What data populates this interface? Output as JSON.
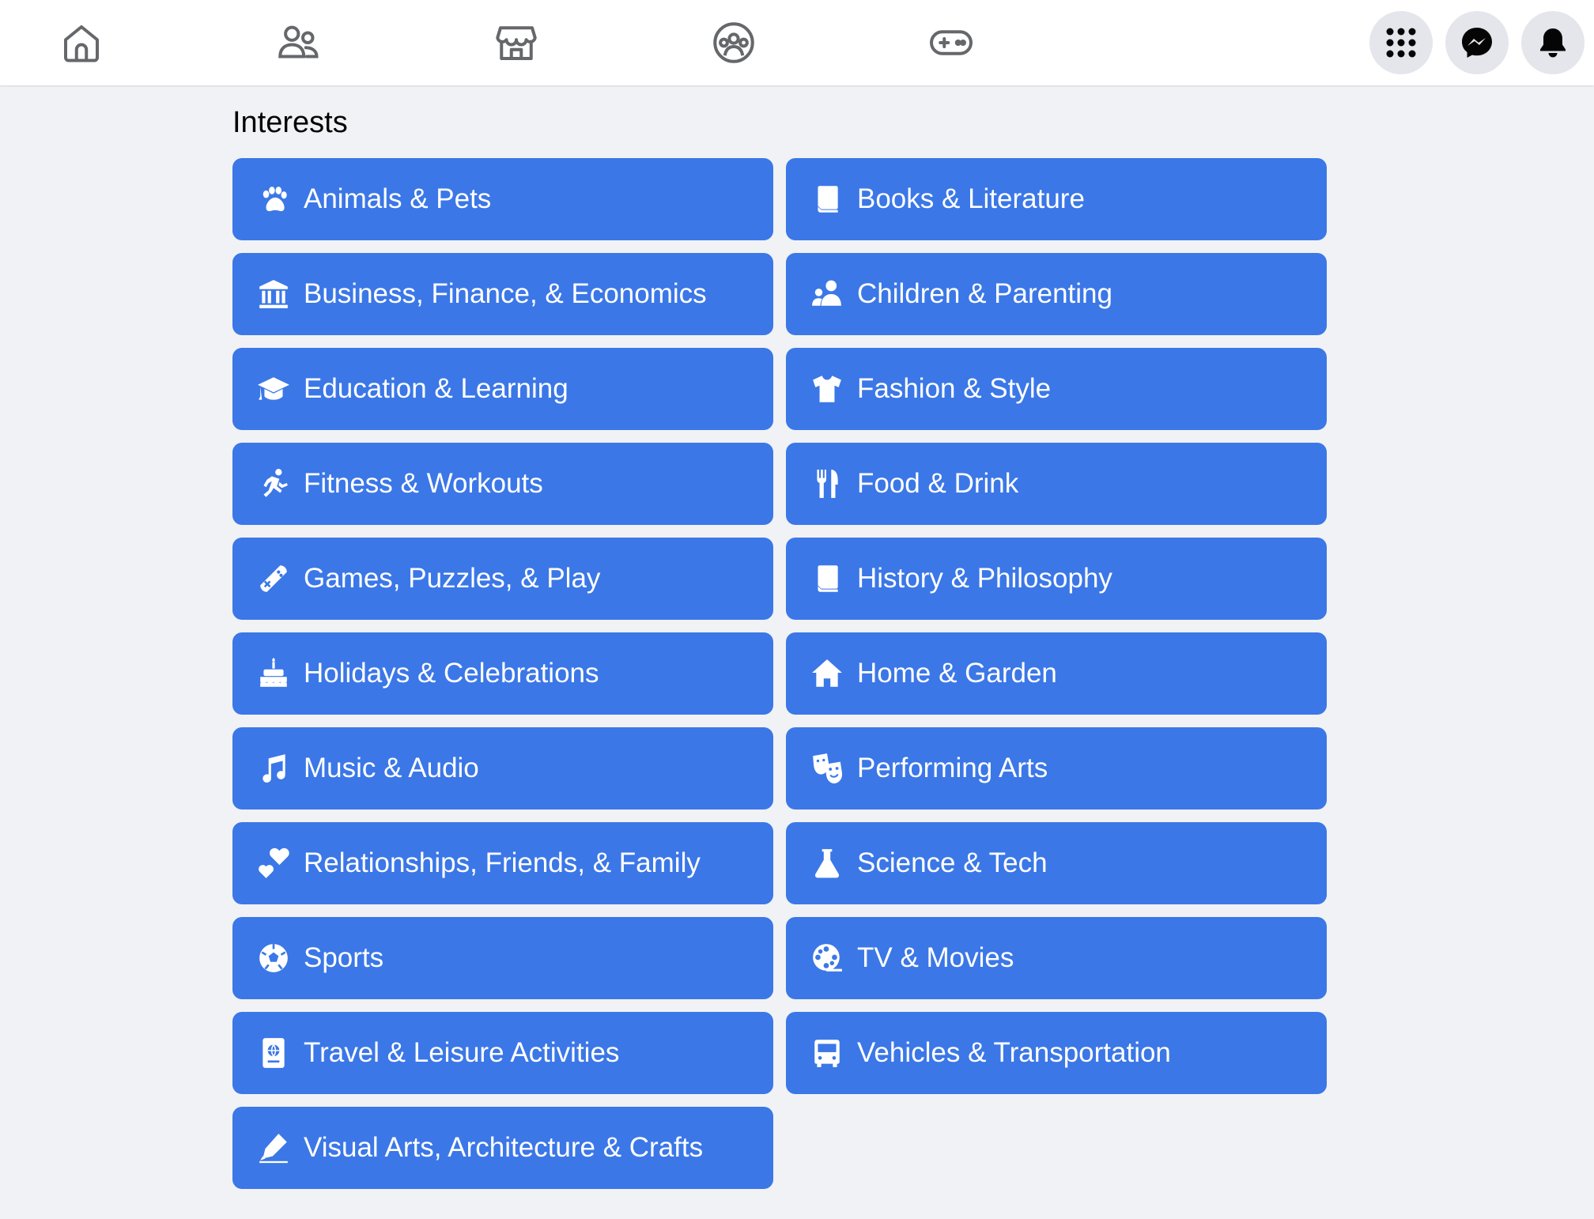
{
  "nav": {
    "icons": [
      {
        "name": "home-icon"
      },
      {
        "name": "friends-icon"
      },
      {
        "name": "marketplace-icon"
      },
      {
        "name": "groups-icon"
      },
      {
        "name": "gaming-icon"
      }
    ],
    "right_buttons": [
      {
        "name": "menu-grid-icon"
      },
      {
        "name": "messenger-icon"
      },
      {
        "name": "notifications-bell-icon"
      }
    ]
  },
  "page": {
    "title": "Interests"
  },
  "colors": {
    "tile": "#3b77e7",
    "background": "#f0f2f5",
    "topbar": "#ffffff",
    "nav_icon": "#65676b"
  },
  "interests": [
    {
      "label": "Animals & Pets",
      "icon": "paw-icon"
    },
    {
      "label": "Books & Literature",
      "icon": "book-icon"
    },
    {
      "label": "Business, Finance, & Economics",
      "icon": "bank-icon"
    },
    {
      "label": "Children & Parenting",
      "icon": "parent-child-icon"
    },
    {
      "label": "Education & Learning",
      "icon": "graduation-cap-icon"
    },
    {
      "label": "Fashion & Style",
      "icon": "tshirt-icon"
    },
    {
      "label": "Fitness & Workouts",
      "icon": "running-person-icon"
    },
    {
      "label": "Food & Drink",
      "icon": "fork-knife-icon"
    },
    {
      "label": "Games, Puzzles, & Play",
      "icon": "game-controller-icon"
    },
    {
      "label": "History & Philosophy",
      "icon": "book-icon"
    },
    {
      "label": "Holidays & Celebrations",
      "icon": "cake-icon"
    },
    {
      "label": "Home & Garden",
      "icon": "house-icon"
    },
    {
      "label": "Music & Audio",
      "icon": "music-note-icon"
    },
    {
      "label": "Performing Arts",
      "icon": "theater-masks-icon"
    },
    {
      "label": "Relationships, Friends, & Family",
      "icon": "hearts-icon"
    },
    {
      "label": "Science & Tech",
      "icon": "flask-icon"
    },
    {
      "label": "Sports",
      "icon": "soccer-ball-icon"
    },
    {
      "label": "TV & Movies",
      "icon": "film-reel-icon"
    },
    {
      "label": "Travel & Leisure Activities",
      "icon": "passport-icon"
    },
    {
      "label": "Vehicles & Transportation",
      "icon": "bus-icon"
    },
    {
      "label": "Visual Arts, Architecture & Crafts",
      "icon": "pen-icon"
    }
  ]
}
